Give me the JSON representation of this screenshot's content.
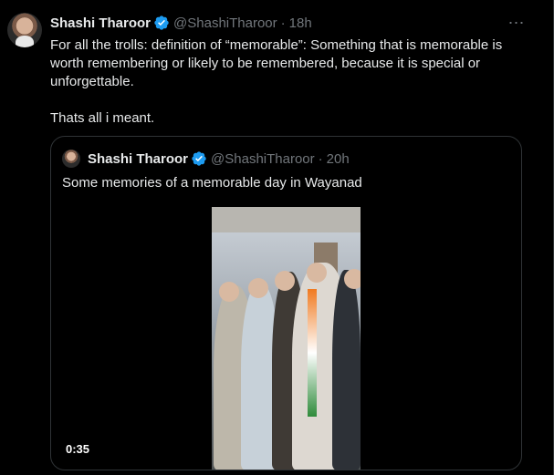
{
  "tweet": {
    "author_name": "Shashi Tharoor",
    "handle": "@ShashiTharoor",
    "dot": "·",
    "time": "18h",
    "more_icon": "more-icon",
    "body": [
      "For all the trolls: definition of “memorable”: Something that is memorable is worth remembering or likely to be remembered, because it is special or unforgettable.",
      "Thats all i meant."
    ],
    "verified_icon": "verified-badge-icon",
    "verified_color": "#1d9bf0"
  },
  "quote": {
    "author_name": "Shashi Tharoor",
    "handle": "@ShashiTharoor",
    "dot": "·",
    "time": "20h",
    "text": "Some memories of a memorable day in Wayanad",
    "video": {
      "duration": "0:35"
    }
  },
  "colors": {
    "background": "#000000",
    "text": "#e7e9ea",
    "muted": "#71767b",
    "border": "#2f3336"
  }
}
